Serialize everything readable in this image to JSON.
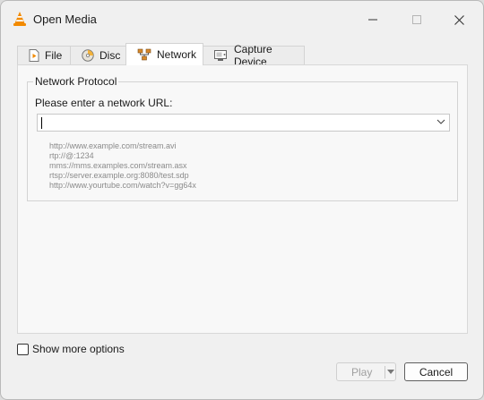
{
  "window": {
    "title": "Open Media",
    "app_icon": "vlc-cone-icon"
  },
  "tabs": [
    {
      "label": "File",
      "icon": "file-play-icon",
      "active": false
    },
    {
      "label": "Disc",
      "icon": "disc-icon",
      "active": false
    },
    {
      "label": "Network",
      "icon": "network-icon",
      "active": true
    },
    {
      "label": "Capture Device",
      "icon": "capture-device-icon",
      "active": false
    }
  ],
  "network": {
    "group_title": "Network Protocol",
    "url_label": "Please enter a network URL:",
    "url_value": "",
    "examples": [
      "http://www.example.com/stream.avi",
      "rtp://@:1234",
      "mms://mms.examples.com/stream.asx",
      "rtsp://server.example.org:8080/test.sdp",
      "http://www.yourtube.com/watch?v=gg64x"
    ]
  },
  "options": {
    "show_more_label": "Show more options",
    "checked": false
  },
  "buttons": {
    "play_label": "Play",
    "play_enabled": false,
    "cancel_label": "Cancel"
  },
  "colors": {
    "vlc_orange": "#f28a00",
    "window_bg": "#f0f0f0",
    "hint_text": "#8a8a8a"
  }
}
